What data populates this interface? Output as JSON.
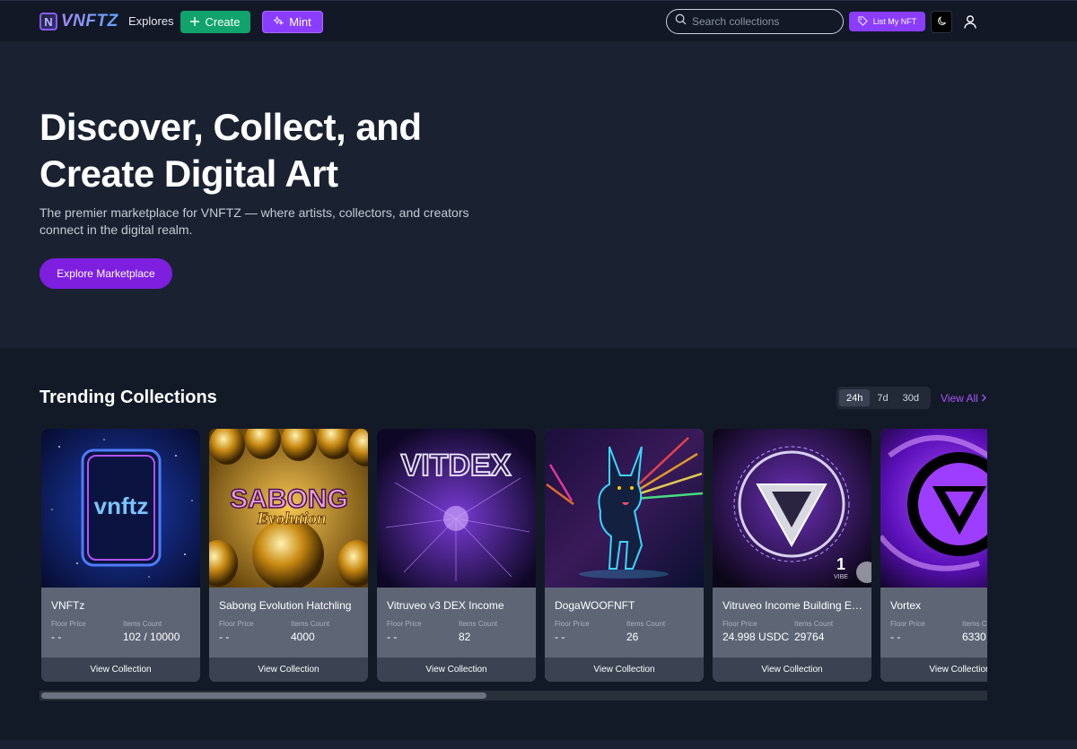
{
  "nav": {
    "logo_mark": "N",
    "logo_text": "VNFTZ",
    "explores": "Explores",
    "create_label": "Create",
    "mint_label": "Mint",
    "search_placeholder": "Search collections",
    "list_label": "List My NFT"
  },
  "hero": {
    "title": "Discover, Collect, and Create Digital Art",
    "subtitle": "The premier marketplace for VNFTZ — where artists, collectors, and creators connect in the digital realm.",
    "cta": "Explore Marketplace"
  },
  "trending": {
    "title": "Trending Collections",
    "ranges": [
      "24h",
      "7d",
      "30d"
    ],
    "active_range": "24h",
    "view_all": "View All",
    "floor_label": "Floor Price",
    "items_label": "Items Count",
    "button_label": "View Collection",
    "collections": [
      {
        "name": "VNFTz",
        "floor": "- -",
        "items": "102 / 10000",
        "art_text": "vnftz"
      },
      {
        "name": "Sabong Evolution Hatchling",
        "floor": "- -",
        "items": "4000",
        "art_text": "SABONG",
        "art_text2": "Evolution"
      },
      {
        "name": "Vitruveo v3 DEX Income",
        "floor": "- -",
        "items": "82",
        "art_text": "VITDEX"
      },
      {
        "name": "DogaWOOFNFT",
        "floor": "- -",
        "items": "26"
      },
      {
        "name": "Vitruveo Income Building En...",
        "floor": "24.998 USDC",
        "items": "29764",
        "art_text": "1",
        "art_text2": "VIBE"
      },
      {
        "name": "Vortex",
        "floor": "- -",
        "items": "6330"
      }
    ],
    "scroll_fraction": 0.47
  },
  "colors": {
    "accent": "#8b3dff",
    "create": "#10a36b",
    "link": "#a855f7",
    "card": "#5e6676"
  }
}
